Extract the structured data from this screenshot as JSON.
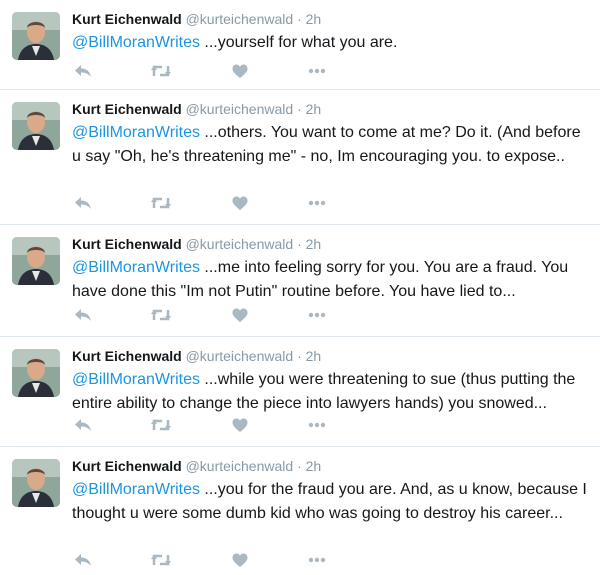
{
  "colors": {
    "name": "#14171a",
    "meta": "#8899a6",
    "mention": "#1b95e0",
    "icon": "#aab8c2",
    "divider": "#e1e8ed"
  },
  "icons": {
    "reply": "reply-icon",
    "retweet": "retweet-icon",
    "like": "heart-icon",
    "more": "more-icon"
  },
  "tweets": [
    {
      "author": "Kurt Eichenwald",
      "handle": "@kurteichenwald",
      "separator": "·",
      "time": "2h",
      "mention": "@BillMoranWrites",
      "text": " ...yourself for what you are."
    },
    {
      "author": "Kurt Eichenwald",
      "handle": "@kurteichenwald",
      "separator": "·",
      "time": "2h",
      "mention": "@BillMoranWrites",
      "text": " ...others. You want to come at me? Do it. (And before u say \"Oh, he's threatening me\" - no, Im encouraging you. to expose.."
    },
    {
      "author": "Kurt Eichenwald",
      "handle": "@kurteichenwald",
      "separator": "·",
      "time": "2h",
      "mention": "@BillMoranWrites",
      "text": " ...me into feeling sorry for you. You are a fraud. You have done this \"Im not Putin\" routine before. You have lied to..."
    },
    {
      "author": "Kurt Eichenwald",
      "handle": "@kurteichenwald",
      "separator": "·",
      "time": "2h",
      "mention": "@BillMoranWrites",
      "text": " ...while you were threatening to sue (thus putting the entire ability to change the piece into lawyers hands) you snowed..."
    },
    {
      "author": "Kurt Eichenwald",
      "handle": "@kurteichenwald",
      "separator": "·",
      "time": "2h",
      "mention": "@BillMoranWrites",
      "text": " ...you for the fraud you are. And, as u know, because I thought u were some dumb kid who was going to destroy his career..."
    }
  ]
}
